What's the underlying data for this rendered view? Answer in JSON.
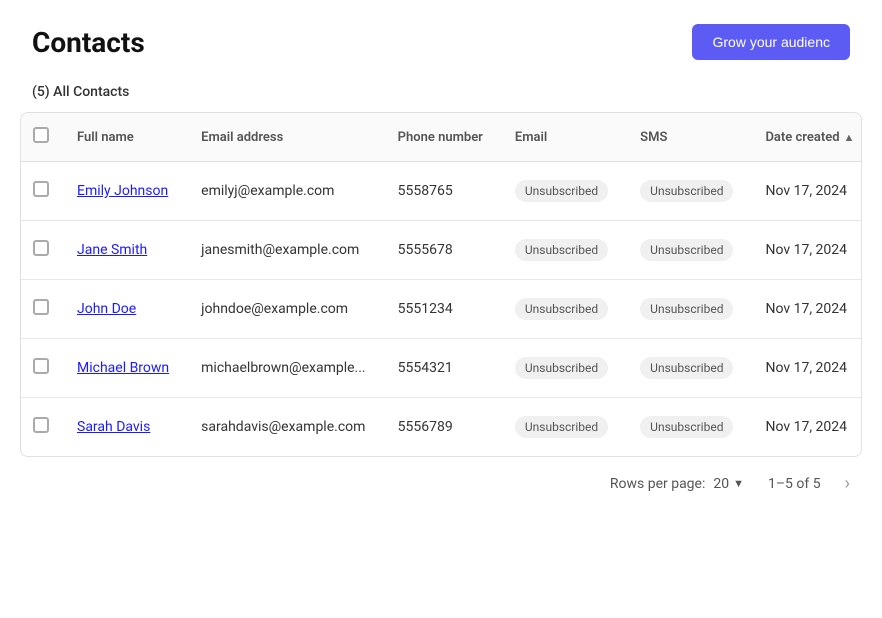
{
  "header": {
    "title": "Contacts",
    "grow_button_label": "Grow your audienc"
  },
  "sub_header": {
    "label": "(5) All Contacts"
  },
  "table": {
    "columns": [
      {
        "key": "checkbox",
        "label": ""
      },
      {
        "key": "full_name",
        "label": "Full name"
      },
      {
        "key": "email_address",
        "label": "Email address"
      },
      {
        "key": "phone_number",
        "label": "Phone number"
      },
      {
        "key": "email",
        "label": "Email"
      },
      {
        "key": "sms",
        "label": "SMS"
      },
      {
        "key": "date_created",
        "label": "Date created"
      }
    ],
    "rows": [
      {
        "full_name": "Emily Johnson",
        "email_address": "emilyj@example.com",
        "phone_number": "5558765",
        "email_status": "Unsubscribed",
        "sms_status": "Unsubscribed",
        "date_created": "Nov 17, 2024"
      },
      {
        "full_name": "Jane Smith",
        "email_address": "janesmith@example.com",
        "phone_number": "5555678",
        "email_status": "Unsubscribed",
        "sms_status": "Unsubscribed",
        "date_created": "Nov 17, 2024"
      },
      {
        "full_name": "John Doe",
        "email_address": "johndoe@example.com",
        "phone_number": "5551234",
        "email_status": "Unsubscribed",
        "sms_status": "Unsubscribed",
        "date_created": "Nov 17, 2024"
      },
      {
        "full_name": "Michael Brown",
        "email_address": "michaelbrown@example...",
        "phone_number": "5554321",
        "email_status": "Unsubscribed",
        "sms_status": "Unsubscribed",
        "date_created": "Nov 17, 2024"
      },
      {
        "full_name": "Sarah Davis",
        "email_address": "sarahdavis@example.com",
        "phone_number": "5556789",
        "email_status": "Unsubscribed",
        "sms_status": "Unsubscribed",
        "date_created": "Nov 17, 2024"
      }
    ]
  },
  "footer": {
    "rows_per_page_label": "Rows per page:",
    "rows_per_page_value": "20",
    "pagination_info": "1–5 of 5"
  }
}
